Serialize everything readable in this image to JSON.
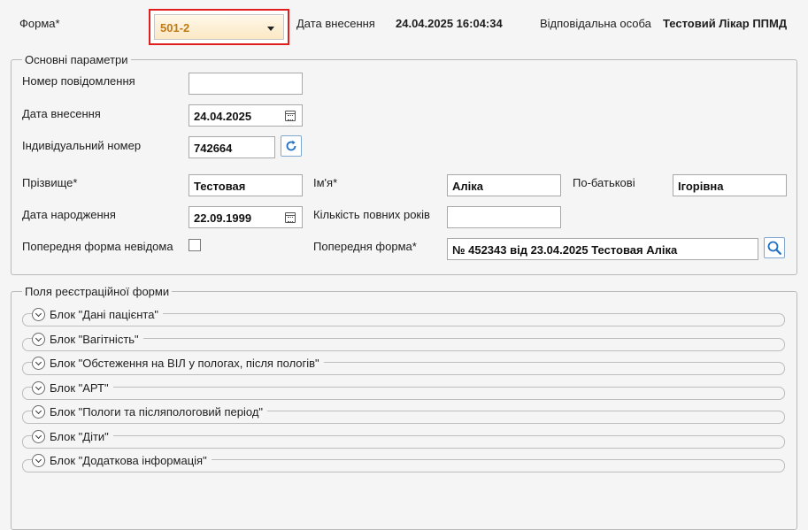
{
  "header": {
    "form_label": "Форма*",
    "form_value": "501-2",
    "date_label": "Дата внесення",
    "date_value": "24.04.2025 16:04:34",
    "responsible_label": "Відповідальна особа",
    "responsible_value": "Тестовий Лікар ППМД"
  },
  "main_params": {
    "title": "Основні параметри",
    "message_number_label": "Номер повідомлення",
    "message_number_value": "",
    "entry_date_label": "Дата внесення",
    "entry_date_value": "24.04.2025",
    "individual_number_label": "Індивідуальний номер",
    "individual_number_value": "742664",
    "surname_label": "Прізвище*",
    "surname_value": "Тестовая",
    "name_label": "Ім'я*",
    "name_value": "Аліка",
    "patronymic_label": "По-батькові",
    "patronymic_value": "Ігорівна",
    "birth_date_label": "Дата народження",
    "birth_date_value": "22.09.1999",
    "full_years_label": "Кількість повних років",
    "full_years_value": "",
    "prev_form_unknown_label": "Попередня форма невідома",
    "prev_form_unknown_checked": false,
    "prev_form_label": "Попередня форма*",
    "prev_form_value": "№ 452343 від 23.04.2025 Тестовая Аліка"
  },
  "registration_fields": {
    "title": "Поля реєстраційної форми",
    "blocks": [
      {
        "label": "Блок \"Дані пацієнта\""
      },
      {
        "label": "Блок \"Вагітність\""
      },
      {
        "label": "Блок \"Обстеження на ВІЛ у пологах, після пологів\""
      },
      {
        "label": "Блок \"АРТ\""
      },
      {
        "label": "Блок \"Пологи та післяпологовий період\""
      },
      {
        "label": "Блок \"Діти\""
      },
      {
        "label": "Блок \"Додаткова інформація\""
      }
    ]
  },
  "icons": {
    "calendar": "calendar-icon",
    "refresh": "refresh-icon",
    "search": "search-icon",
    "expand": "chevron-down-icon"
  },
  "colors": {
    "highlight_border": "#e01e1e",
    "select_text": "#c07a12",
    "icon_blue": "#1f6fc3"
  }
}
